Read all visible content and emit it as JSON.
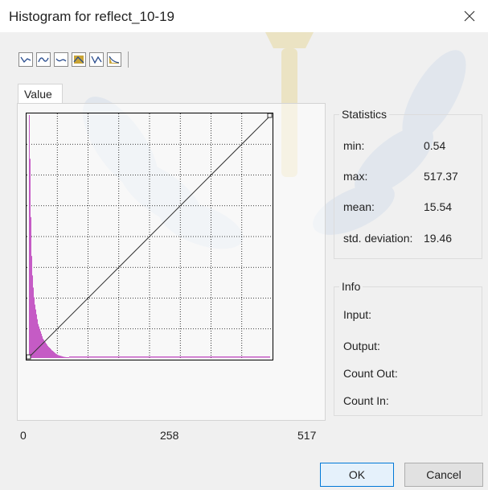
{
  "window": {
    "title": "Histogram for reflect_10-19",
    "close_icon": "close-icon"
  },
  "toolbar": {
    "buttons": [
      {
        "icon": "linear-curve-icon"
      },
      {
        "icon": "smooth-curve-icon"
      },
      {
        "icon": "log-curve-icon"
      },
      {
        "icon": "equalize-icon"
      },
      {
        "icon": "sigmoid-curve-icon"
      },
      {
        "icon": "histogram-fill-icon"
      }
    ]
  },
  "tab": {
    "label": "Value"
  },
  "chart_data": {
    "type": "bar",
    "xlim": [
      0.54,
      517.37
    ],
    "x_tick_labels": [
      "0",
      "258",
      "517"
    ],
    "grid": true,
    "color": "#c55bc5",
    "histogram_counts": [
      100,
      82,
      58,
      42,
      34,
      29,
      25,
      22,
      20,
      18,
      16,
      14,
      13,
      12,
      11,
      10,
      9,
      8,
      7.5,
      7,
      6.5,
      6,
      5.5,
      5,
      4.6,
      4.3,
      4,
      3.6,
      3.2,
      3,
      2.7,
      2.4,
      2.1,
      1.8,
      1.6,
      1.4,
      1.2,
      1.1,
      1,
      0.9,
      0.8,
      0.7,
      0.6,
      0.5,
      0.45,
      0.4,
      0.35,
      0.3,
      0.25,
      0.2
    ],
    "transfer_line": {
      "from": [
        0,
        0
      ],
      "to": [
        1,
        1
      ]
    }
  },
  "axis": {
    "min_label": "0",
    "mid_label": "258",
    "max_label": "517"
  },
  "statistics": {
    "title": "Statistics",
    "min_label": "min:",
    "min_value": "0.54",
    "max_label": "max:",
    "max_value": "517.37",
    "mean_label": "mean:",
    "mean_value": "15.54",
    "std_label": "std. deviation:",
    "std_value": "19.46"
  },
  "info": {
    "title": "Info",
    "input_label": "Input:",
    "output_label": "Output:",
    "count_out_label": "Count Out:",
    "count_in_label": "Count In:"
  },
  "buttons": {
    "ok": "OK",
    "cancel": "Cancel"
  },
  "colors": {
    "accent": "#0078d7",
    "histogram": "#c55bc5"
  }
}
